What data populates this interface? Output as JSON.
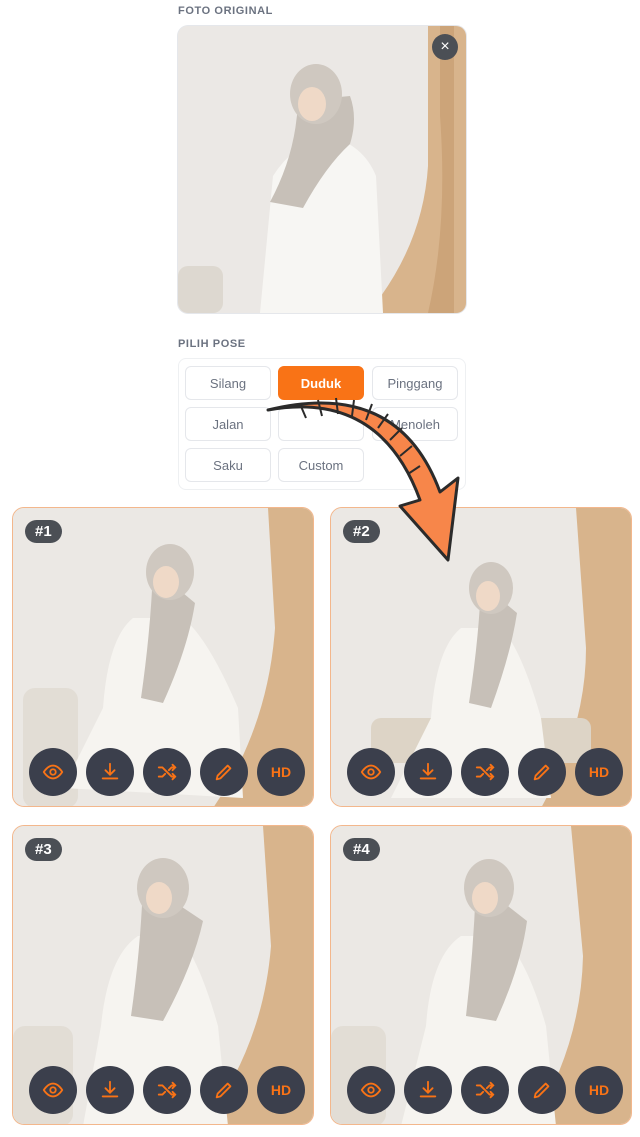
{
  "original": {
    "section_label": "FOTO ORIGINAL",
    "close_symbol": "×"
  },
  "pose": {
    "section_label": "PILIH POSE",
    "options": [
      {
        "label": "Silang",
        "active": false
      },
      {
        "label": "Duduk",
        "active": true
      },
      {
        "label": "Pinggang",
        "active": false
      },
      {
        "label": "Jalan",
        "active": false
      },
      {
        "label": "",
        "active": false
      },
      {
        "label": "Menoleh",
        "active": false
      },
      {
        "label": "Saku",
        "active": false
      },
      {
        "label": "Custom",
        "active": false
      }
    ]
  },
  "results": [
    {
      "badge": "#1"
    },
    {
      "badge": "#2"
    },
    {
      "badge": "#3"
    },
    {
      "badge": "#4"
    }
  ],
  "actions": {
    "view_icon": "eye-icon",
    "download_icon": "download-icon",
    "shuffle_icon": "shuffle-icon",
    "edit_icon": "pencil-icon",
    "hd_label": "HD"
  },
  "colors": {
    "accent": "#f97316",
    "button_bg": "#3b3f4c",
    "card_border": "#f3b78c"
  }
}
